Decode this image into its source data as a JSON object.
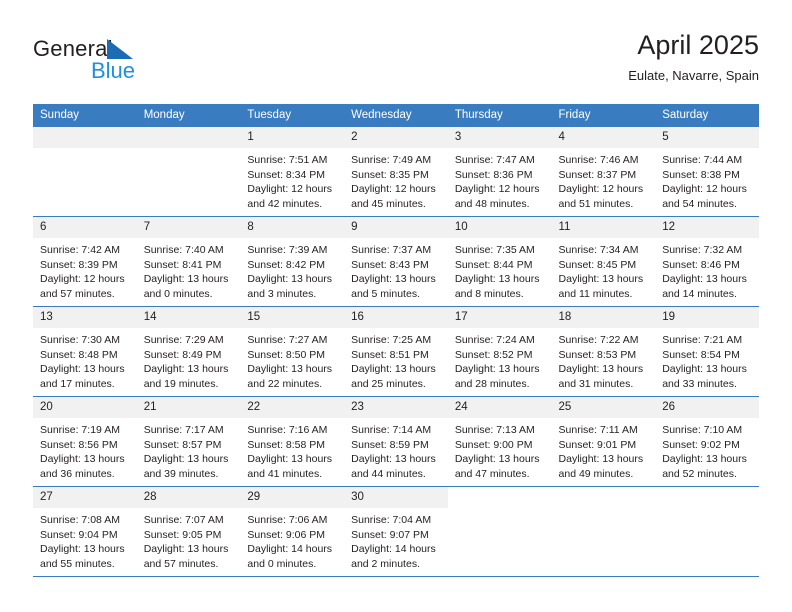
{
  "brand": {
    "name_top": "General",
    "name_bottom": "Blue",
    "triangle_color": "#1b6cb5",
    "blue_text_color": "#1f90e0"
  },
  "header": {
    "month_title": "April 2025",
    "location": "Eulate, Navarre, Spain"
  },
  "theme": {
    "header_blue": "#3a7cc0",
    "daynum_band": "#f1f1f1",
    "text": "#231f20"
  },
  "weekday_headers": [
    "Sunday",
    "Monday",
    "Tuesday",
    "Wednesday",
    "Thursday",
    "Friday",
    "Saturday"
  ],
  "labels": {
    "sunrise_prefix": "Sunrise:",
    "sunset_prefix": "Sunset:",
    "daylight_prefix": "Daylight:"
  },
  "weeks": [
    [
      {
        "day": "",
        "blank": true,
        "line1": "",
        "line2": "",
        "line3": "",
        "line4": ""
      },
      {
        "day": "",
        "blank": true,
        "line1": "",
        "line2": "",
        "line3": "",
        "line4": ""
      },
      {
        "day": "1",
        "line1": "Sunrise: 7:51 AM",
        "line2": "Sunset: 8:34 PM",
        "line3": "Daylight: 12 hours",
        "line4": "and 42 minutes."
      },
      {
        "day": "2",
        "line1": "Sunrise: 7:49 AM",
        "line2": "Sunset: 8:35 PM",
        "line3": "Daylight: 12 hours",
        "line4": "and 45 minutes."
      },
      {
        "day": "3",
        "line1": "Sunrise: 7:47 AM",
        "line2": "Sunset: 8:36 PM",
        "line3": "Daylight: 12 hours",
        "line4": "and 48 minutes."
      },
      {
        "day": "4",
        "line1": "Sunrise: 7:46 AM",
        "line2": "Sunset: 8:37 PM",
        "line3": "Daylight: 12 hours",
        "line4": "and 51 minutes."
      },
      {
        "day": "5",
        "line1": "Sunrise: 7:44 AM",
        "line2": "Sunset: 8:38 PM",
        "line3": "Daylight: 12 hours",
        "line4": "and 54 minutes."
      }
    ],
    [
      {
        "day": "6",
        "line1": "Sunrise: 7:42 AM",
        "line2": "Sunset: 8:39 PM",
        "line3": "Daylight: 12 hours",
        "line4": "and 57 minutes."
      },
      {
        "day": "7",
        "line1": "Sunrise: 7:40 AM",
        "line2": "Sunset: 8:41 PM",
        "line3": "Daylight: 13 hours",
        "line4": "and 0 minutes."
      },
      {
        "day": "8",
        "line1": "Sunrise: 7:39 AM",
        "line2": "Sunset: 8:42 PM",
        "line3": "Daylight: 13 hours",
        "line4": "and 3 minutes."
      },
      {
        "day": "9",
        "line1": "Sunrise: 7:37 AM",
        "line2": "Sunset: 8:43 PM",
        "line3": "Daylight: 13 hours",
        "line4": "and 5 minutes."
      },
      {
        "day": "10",
        "line1": "Sunrise: 7:35 AM",
        "line2": "Sunset: 8:44 PM",
        "line3": "Daylight: 13 hours",
        "line4": "and 8 minutes."
      },
      {
        "day": "11",
        "line1": "Sunrise: 7:34 AM",
        "line2": "Sunset: 8:45 PM",
        "line3": "Daylight: 13 hours",
        "line4": "and 11 minutes."
      },
      {
        "day": "12",
        "line1": "Sunrise: 7:32 AM",
        "line2": "Sunset: 8:46 PM",
        "line3": "Daylight: 13 hours",
        "line4": "and 14 minutes."
      }
    ],
    [
      {
        "day": "13",
        "line1": "Sunrise: 7:30 AM",
        "line2": "Sunset: 8:48 PM",
        "line3": "Daylight: 13 hours",
        "line4": "and 17 minutes."
      },
      {
        "day": "14",
        "line1": "Sunrise: 7:29 AM",
        "line2": "Sunset: 8:49 PM",
        "line3": "Daylight: 13 hours",
        "line4": "and 19 minutes."
      },
      {
        "day": "15",
        "line1": "Sunrise: 7:27 AM",
        "line2": "Sunset: 8:50 PM",
        "line3": "Daylight: 13 hours",
        "line4": "and 22 minutes."
      },
      {
        "day": "16",
        "line1": "Sunrise: 7:25 AM",
        "line2": "Sunset: 8:51 PM",
        "line3": "Daylight: 13 hours",
        "line4": "and 25 minutes."
      },
      {
        "day": "17",
        "line1": "Sunrise: 7:24 AM",
        "line2": "Sunset: 8:52 PM",
        "line3": "Daylight: 13 hours",
        "line4": "and 28 minutes."
      },
      {
        "day": "18",
        "line1": "Sunrise: 7:22 AM",
        "line2": "Sunset: 8:53 PM",
        "line3": "Daylight: 13 hours",
        "line4": "and 31 minutes."
      },
      {
        "day": "19",
        "line1": "Sunrise: 7:21 AM",
        "line2": "Sunset: 8:54 PM",
        "line3": "Daylight: 13 hours",
        "line4": "and 33 minutes."
      }
    ],
    [
      {
        "day": "20",
        "line1": "Sunrise: 7:19 AM",
        "line2": "Sunset: 8:56 PM",
        "line3": "Daylight: 13 hours",
        "line4": "and 36 minutes."
      },
      {
        "day": "21",
        "line1": "Sunrise: 7:17 AM",
        "line2": "Sunset: 8:57 PM",
        "line3": "Daylight: 13 hours",
        "line4": "and 39 minutes."
      },
      {
        "day": "22",
        "line1": "Sunrise: 7:16 AM",
        "line2": "Sunset: 8:58 PM",
        "line3": "Daylight: 13 hours",
        "line4": "and 41 minutes."
      },
      {
        "day": "23",
        "line1": "Sunrise: 7:14 AM",
        "line2": "Sunset: 8:59 PM",
        "line3": "Daylight: 13 hours",
        "line4": "and 44 minutes."
      },
      {
        "day": "24",
        "line1": "Sunrise: 7:13 AM",
        "line2": "Sunset: 9:00 PM",
        "line3": "Daylight: 13 hours",
        "line4": "and 47 minutes."
      },
      {
        "day": "25",
        "line1": "Sunrise: 7:11 AM",
        "line2": "Sunset: 9:01 PM",
        "line3": "Daylight: 13 hours",
        "line4": "and 49 minutes."
      },
      {
        "day": "26",
        "line1": "Sunrise: 7:10 AM",
        "line2": "Sunset: 9:02 PM",
        "line3": "Daylight: 13 hours",
        "line4": "and 52 minutes."
      }
    ],
    [
      {
        "day": "27",
        "line1": "Sunrise: 7:08 AM",
        "line2": "Sunset: 9:04 PM",
        "line3": "Daylight: 13 hours",
        "line4": "and 55 minutes."
      },
      {
        "day": "28",
        "line1": "Sunrise: 7:07 AM",
        "line2": "Sunset: 9:05 PM",
        "line3": "Daylight: 13 hours",
        "line4": "and 57 minutes."
      },
      {
        "day": "29",
        "line1": "Sunrise: 7:06 AM",
        "line2": "Sunset: 9:06 PM",
        "line3": "Daylight: 14 hours",
        "line4": "and 0 minutes."
      },
      {
        "day": "30",
        "line1": "Sunrise: 7:04 AM",
        "line2": "Sunset: 9:07 PM",
        "line3": "Daylight: 14 hours",
        "line4": "and 2 minutes."
      },
      {
        "day": "",
        "outside": true,
        "line1": "",
        "line2": "",
        "line3": "",
        "line4": ""
      },
      {
        "day": "",
        "outside": true,
        "line1": "",
        "line2": "",
        "line3": "",
        "line4": ""
      },
      {
        "day": "",
        "outside": true,
        "line1": "",
        "line2": "",
        "line3": "",
        "line4": ""
      }
    ]
  ]
}
